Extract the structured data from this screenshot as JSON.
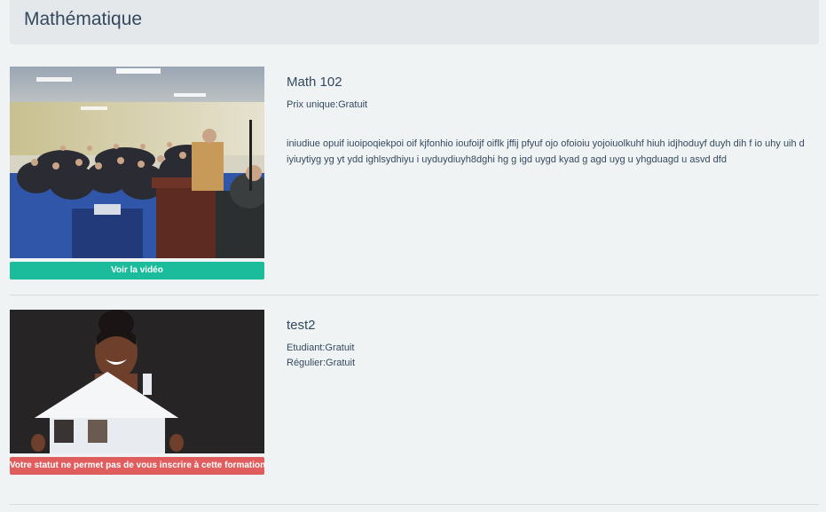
{
  "header": {
    "title": "Mathématique"
  },
  "courses": [
    {
      "title": "Math 102",
      "prices": [
        "Prix unique:Gratuit"
      ],
      "description": "iniudiue opuif iuoipoqiekpoi oif kjfonhio ioufoijf oiflk jffij pfyuf ojo ofoioiu yojoiuolkuhf hiuh idjhoduyf duyh dih f io uhy uih d iyiuytiyg yg yt ydd ighlsydhiyu i uyduydiuyh8dghi hg g igd uygd kyad g agd uyg u yhgduagd u asvd dfd",
      "button": "Voir la vidéo",
      "button_color": "#1abc9c"
    },
    {
      "title": "test2",
      "prices": [
        "Etudiant:Gratuit",
        "Régulier:Gratuit"
      ],
      "description": "",
      "button": "Votre statut ne permet pas de vous inscrire à cette formation",
      "button_color": "#e05d5d"
    }
  ]
}
